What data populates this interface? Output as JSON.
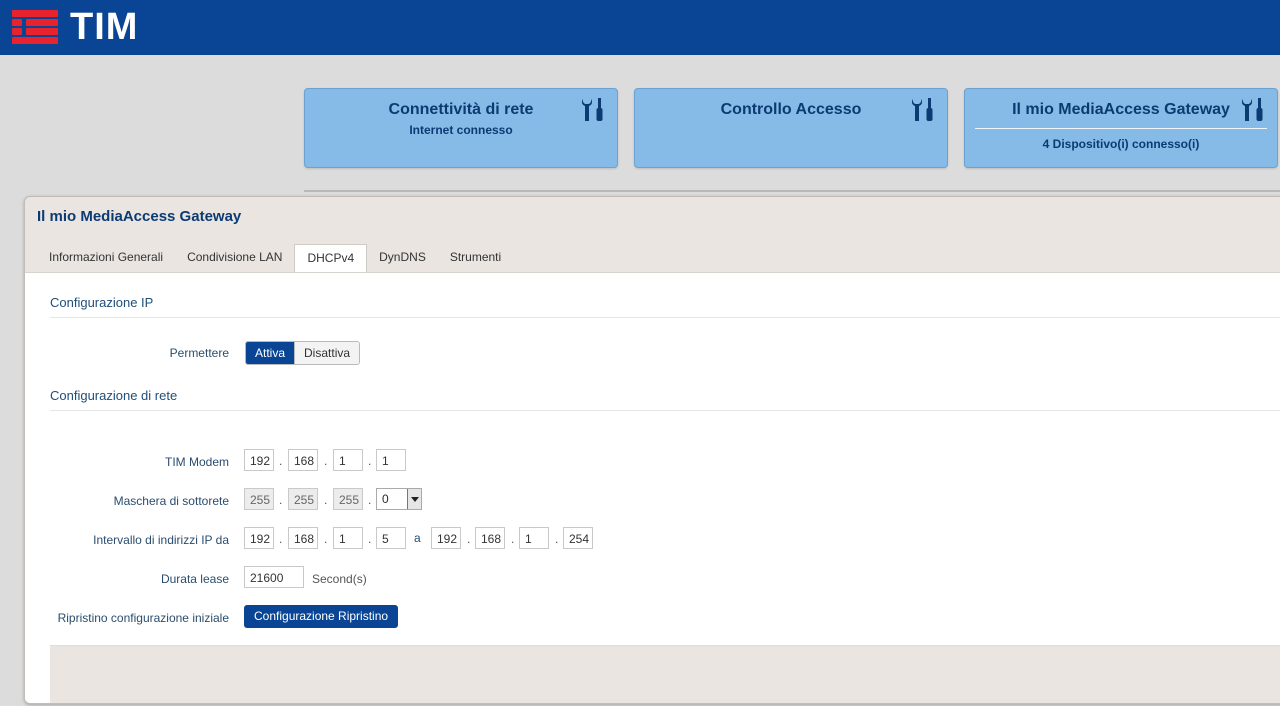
{
  "brand": {
    "logo_text": "TIM",
    "color_primary": "#0a4595",
    "color_logo_red": "#e8232d"
  },
  "cards": [
    {
      "title": "Connettività di rete",
      "subtitle": "Internet connesso",
      "icon": "tools-icon"
    },
    {
      "title": "Controllo Accesso",
      "subtitle": "",
      "icon": "tools-icon"
    },
    {
      "title": "Il mio MediaAccess Gateway",
      "subtitle": "4 Dispositivo(i) connesso(i)",
      "icon": "tools-icon"
    }
  ],
  "panel": {
    "title": "Il mio MediaAccess Gateway",
    "tabs": [
      {
        "label": "Informazioni Generali",
        "active": false
      },
      {
        "label": "Condivisione LAN",
        "active": false
      },
      {
        "label": "DHCPv4",
        "active": true
      },
      {
        "label": "DynDNS",
        "active": false
      },
      {
        "label": "Strumenti",
        "active": false
      }
    ]
  },
  "ip_config": {
    "section_title": "Configurazione IP",
    "permettere_label": "Permettere",
    "toggle_on": "Attiva",
    "toggle_off": "Disattiva"
  },
  "network_config": {
    "section_title": "Configurazione di rete",
    "modem_label": "TIM Modem",
    "modem_ip": [
      "192",
      "168",
      "1",
      "1"
    ],
    "mask_label": "Maschera di sottorete",
    "mask": [
      "255",
      "255",
      "255"
    ],
    "mask_last_selected": "0",
    "range_label": "Intervallo di indirizzi IP da",
    "range_from": [
      "192",
      "168",
      "1",
      "5"
    ],
    "range_sep": "a",
    "range_to": [
      "192",
      "168",
      "1",
      "254"
    ],
    "lease_label": "Durata lease",
    "lease_value": "21600",
    "lease_unit": "Second(s)",
    "reset_label": "Ripristino configurazione iniziale",
    "reset_button": "Configurazione Ripristino"
  }
}
